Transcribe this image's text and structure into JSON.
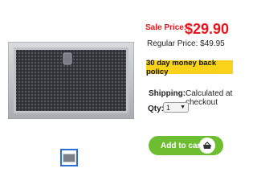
{
  "pricing": {
    "sale_label": "Sale Price:",
    "sale_price": "$29.90",
    "regular_price": "Regular Price: $49.95"
  },
  "guarantee": {
    "text": "30 day money back policy"
  },
  "shipping": {
    "label": "Shipping:",
    "value": "Calculated at checkout"
  },
  "quantity": {
    "label": "Qty:",
    "selected": "1"
  },
  "cart": {
    "label": "Add to cart"
  },
  "colors": {
    "sale": "#e8151b",
    "badge": "#f9d31a",
    "cart_button": "#6cbd2f",
    "thumb_border": "#2a6fd6"
  }
}
